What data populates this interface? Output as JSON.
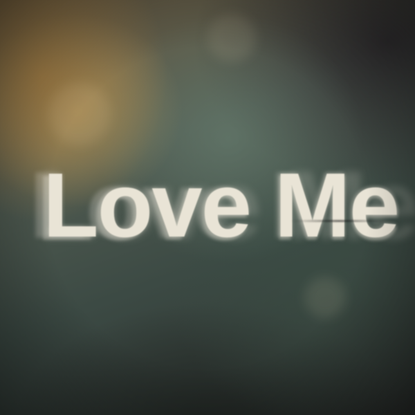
{
  "title": {
    "text": "Love Me"
  },
  "colors": {
    "text": "#e9e4d6",
    "glow_warm": "#aa8246",
    "haze_green": "#6e8778",
    "shadow": "#2a2d2b"
  }
}
